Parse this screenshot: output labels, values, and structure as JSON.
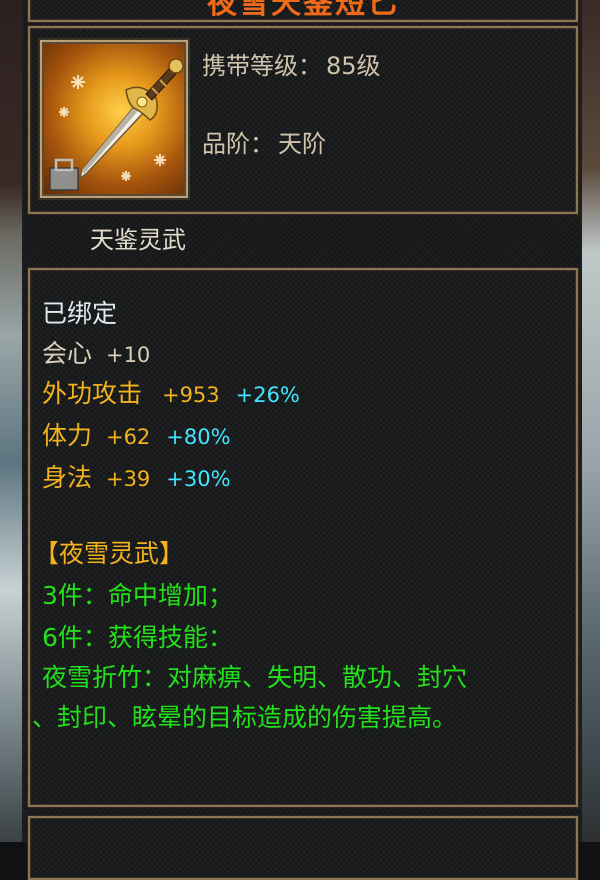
{
  "tooltip": {
    "title": "夜雪天鉴短匕",
    "item_icon": "golden-dagger-icon",
    "level_label": "携带等级：",
    "level_value": "85级",
    "grade_label": "品阶：",
    "grade_value": "天阶",
    "item_name": "天鉴灵武",
    "bind_status": "已绑定",
    "stats": [
      {
        "name": "会心",
        "value": "+10",
        "bonus": ""
      },
      {
        "name": "外功攻击",
        "value": "+953",
        "bonus": "+26%"
      },
      {
        "name": "体力",
        "value": "+62",
        "bonus": "+80%"
      },
      {
        "name": "身法",
        "value": "+39",
        "bonus": "+30%"
      }
    ],
    "set_name": "【夜雪灵武】",
    "set_bonus_3": "3件：命中增加；",
    "set_bonus_6": "6件：获得技能：",
    "skill_line_1": "夜雪折竹：对麻痹、失明、散功、封穴",
    "skill_line_2": "、封印、眩晕的目标造成的伤害提高。"
  },
  "colors": {
    "title": "#f06a1a",
    "frame_border": "#8a7554",
    "stat_name_orange": "#f4b21c",
    "bonus_cyan": "#40e6ff",
    "set_green": "#22e01a",
    "bind_white": "#dfeaf0"
  }
}
